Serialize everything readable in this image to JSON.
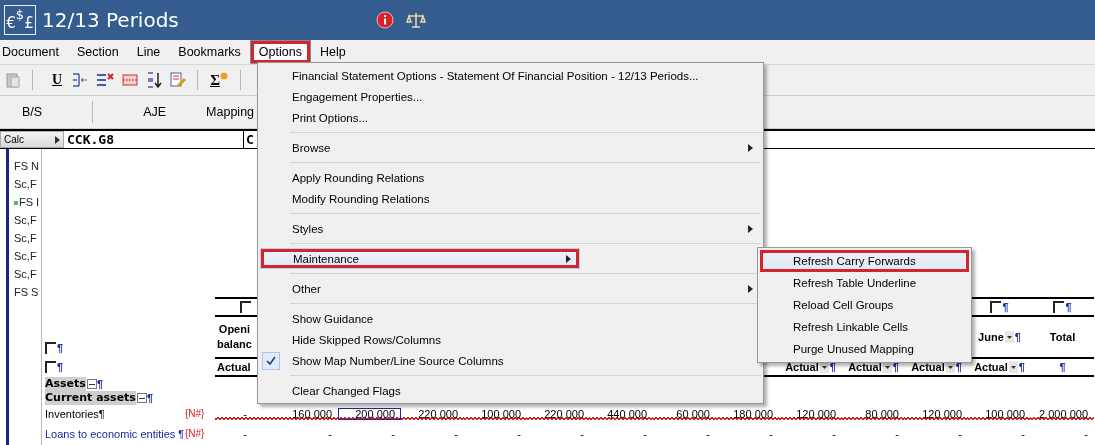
{
  "window": {
    "logo_glyphs": [
      "€",
      "$",
      "£"
    ],
    "title": "12/13 Periods"
  },
  "menubar": [
    {
      "label": "Document",
      "selected": false,
      "annotated": false
    },
    {
      "label": "Section",
      "selected": false,
      "annotated": false
    },
    {
      "label": "Line",
      "selected": false,
      "annotated": false
    },
    {
      "label": "Bookmarks",
      "selected": false,
      "annotated": false
    },
    {
      "label": "Options",
      "selected": true,
      "annotated": true
    },
    {
      "label": "Help",
      "selected": false,
      "annotated": false
    }
  ],
  "toolbar": [
    {
      "kind": "paste"
    },
    {
      "kind": "separator"
    },
    {
      "kind": "underline",
      "label": "U"
    },
    {
      "kind": "indent"
    },
    {
      "kind": "delete"
    },
    {
      "kind": "table"
    },
    {
      "kind": "sort"
    },
    {
      "kind": "edit"
    },
    {
      "kind": "separator"
    },
    {
      "kind": "sigma",
      "label": "Σ"
    },
    {
      "kind": "separator"
    }
  ],
  "view_tabs": [
    "B/S",
    "AJE",
    "Mapping"
  ],
  "formula_bar": {
    "button": "Calc",
    "cell_ref": "CCK.G8",
    "field_2": "C"
  },
  "sidebar": {
    "items": [
      {
        "label": "FS N",
        "marked": false
      },
      {
        "label": "Sc,F",
        "marked": false
      },
      {
        "label": "FS I",
        "marked": true
      },
      {
        "label": "Sc,F",
        "marked": false
      },
      {
        "label": "Sc,F",
        "marked": false
      },
      {
        "label": "Sc,F",
        "marked": false
      },
      {
        "label": "Sc,F",
        "marked": false
      },
      {
        "label": "FS S",
        "marked": false
      }
    ]
  },
  "document": {
    "left_marks": [
      {
        "checked": false,
        "end_mark": "¶"
      },
      {
        "checked": false,
        "end_mark": "¶"
      }
    ],
    "columns": [
      {
        "checkbox": {
          "checked": false
        },
        "heading": [
          "Openi",
          "balanc"
        ],
        "heading_dropdown": false,
        "basis": {
          "label": "Actual",
          "dropdown": false
        }
      },
      {},
      {},
      {},
      {},
      {},
      {},
      {},
      {},
      {
        "basis": {
          "label": "Actual",
          "dropdown": true,
          "end_mark": "¶"
        }
      },
      {
        "basis": {
          "label": "Actual",
          "dropdown": true,
          "end_mark": "¶"
        }
      },
      {
        "basis": {
          "label": "Actual",
          "dropdown": true,
          "end_mark": "¶"
        }
      },
      {
        "checkbox": {
          "checked": false,
          "end_mark": "¶"
        },
        "heading": [
          "June"
        ],
        "heading_dropdown": true,
        "heading_end_mark": "¶",
        "basis": {
          "label": "Actual",
          "dropdown": true,
          "end_mark": "¶"
        }
      },
      {
        "checkbox": {
          "checked": false,
          "end_mark": "¶"
        },
        "heading": [
          "Total"
        ],
        "heading_dropdown": false,
        "basis": {
          "end_mark": "¶"
        }
      }
    ],
    "rows": [
      {
        "kind": "section",
        "label": "Assets",
        "expanded": true,
        "end_mark": "¶"
      },
      {
        "kind": "section",
        "label": "Current assets",
        "expanded": true,
        "end_mark": "¶"
      },
      {
        "kind": "line",
        "label": "Inventories¶",
        "map": "{N#}",
        "flagged": true,
        "cells": [
          {
            "value": "-",
            "selected": false
          },
          {
            "value": "160 000",
            "selected": false
          },
          {
            "value": "200 000",
            "selected": true
          },
          {
            "value": "220 000",
            "selected": false
          },
          {
            "value": "100 000",
            "selected": false
          },
          {
            "value": "220 000",
            "selected": false
          },
          {
            "value": "440 000",
            "selected": false
          },
          {
            "value": "60 000",
            "selected": false
          },
          {
            "value": "180 000",
            "selected": false
          },
          {
            "value": "120 000",
            "selected": false
          },
          {
            "value": "80 000",
            "selected": false
          },
          {
            "value": "120 000",
            "selected": false
          },
          {
            "value": "100 000",
            "selected": false
          },
          {
            "value": "2 000 000",
            "selected": false
          }
        ]
      },
      {
        "kind": "linked",
        "label": "Loans to economic entities ¶",
        "map": "{N#}",
        "flagged": false,
        "cells": [
          {
            "value": "-",
            "selected": false
          },
          {
            "value": "-",
            "selected": false
          },
          {
            "value": "-",
            "selected": false
          },
          {
            "value": "-",
            "selected": false
          },
          {
            "value": "-",
            "selected": false
          },
          {
            "value": "-",
            "selected": false
          },
          {
            "value": "-",
            "selected": false
          },
          {
            "value": "-",
            "selected": false
          },
          {
            "value": "-",
            "selected": false
          },
          {
            "value": "-",
            "selected": false
          },
          {
            "value": "-",
            "selected": false
          },
          {
            "value": "-",
            "selected": false
          },
          {
            "value": "-",
            "selected": false
          },
          {
            "value": "-",
            "selected": false
          }
        ]
      }
    ]
  },
  "menu": {
    "groups": [
      [
        {
          "label": "Financial Statement Options - Statement Of Financial Position - 12/13 Periods...",
          "kind": "command",
          "checked": false,
          "selected": false,
          "annotated": false
        },
        {
          "label": "Engagement Properties...",
          "kind": "command",
          "checked": false,
          "selected": false,
          "annotated": false
        },
        {
          "label": "Print Options...",
          "kind": "command",
          "checked": false,
          "selected": false,
          "annotated": false
        }
      ],
      [
        {
          "label": "Browse",
          "kind": "submenu",
          "checked": false,
          "selected": false,
          "annotated": false
        }
      ],
      [
        {
          "label": "Apply Rounding Relations",
          "kind": "command",
          "checked": false,
          "selected": false,
          "annotated": false
        },
        {
          "label": "Modify Rounding Relations",
          "kind": "command",
          "checked": false,
          "selected": false,
          "annotated": false
        }
      ],
      [
        {
          "label": "Styles",
          "kind": "submenu",
          "checked": false,
          "selected": false,
          "annotated": false
        }
      ],
      [
        {
          "label": "Maintenance",
          "kind": "submenu",
          "checked": false,
          "selected": true,
          "annotated": true
        }
      ],
      [
        {
          "label": "Other",
          "kind": "submenu",
          "checked": false,
          "selected": false,
          "annotated": false
        }
      ],
      [
        {
          "label": "Show Guidance",
          "kind": "command",
          "checked": false,
          "selected": false,
          "annotated": false
        },
        {
          "label": "Hide Skipped Rows/Columns",
          "kind": "command",
          "checked": false,
          "selected": false,
          "annotated": false
        },
        {
          "label": "Show Map Number/Line Source Columns",
          "kind": "command",
          "checked": true,
          "selected": false,
          "annotated": false
        }
      ],
      [
        {
          "label": "Clear Changed Flags",
          "kind": "command",
          "checked": false,
          "selected": false,
          "annotated": false
        }
      ]
    ]
  },
  "submenu": {
    "items": [
      {
        "label": "Refresh Carry Forwards",
        "selected": true,
        "annotated": true
      },
      {
        "label": "Refresh Table Underline",
        "selected": false,
        "annotated": false
      },
      {
        "label": "Reload Cell Groups",
        "selected": false,
        "annotated": false
      },
      {
        "label": "Refresh Linkable Cells",
        "selected": false,
        "annotated": false
      },
      {
        "label": "Purge Unused Mapping",
        "selected": false,
        "annotated": false
      }
    ]
  }
}
